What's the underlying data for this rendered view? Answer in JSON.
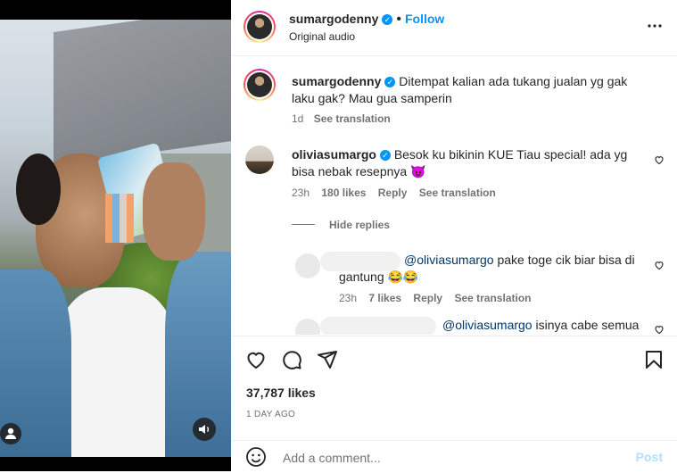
{
  "post": {
    "username": "sumargodenny",
    "follow_label": "Follow",
    "audio": "Original audio",
    "separator": "•"
  },
  "caption": {
    "username": "sumargodenny",
    "text": "Ditempat kalian ada tukang jualan yg gak laku gak? Mau gua samperin",
    "time": "1d",
    "see_translation": "See translation"
  },
  "comments": [
    {
      "username": "oliviasumargo",
      "text": "Besok ku bikinin KUE Tiau special! ada yg bisa nebak resepnya 😈",
      "time": "23h",
      "likes": "180 likes",
      "reply": "Reply",
      "see_translation": "See translation"
    }
  ],
  "hide_replies": "Hide replies",
  "replies": [
    {
      "mention": "@oliviasumargo",
      "text": " pake toge cik biar bisa di gantung 😂😂",
      "time": "23h",
      "likes": "7 likes",
      "reply": "Reply",
      "see_translation": "See translation"
    },
    {
      "mention": "@oliviasumargo",
      "text": " isinya cabe semua"
    }
  ],
  "stats": {
    "likes": "37,787 likes",
    "date": "1 DAY AGO"
  },
  "add_comment": {
    "placeholder": "Add a comment...",
    "post_label": "Post"
  },
  "colors": {
    "accent": "#0095f6",
    "post_disabled": "#b2dffc",
    "meta": "#737373"
  }
}
